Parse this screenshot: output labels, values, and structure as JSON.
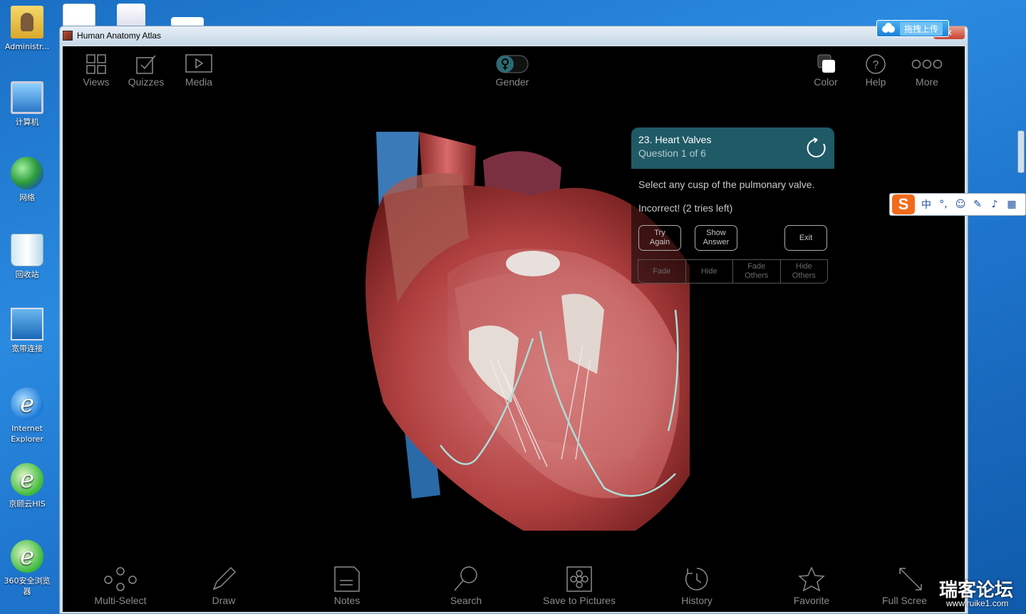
{
  "desktop": {
    "icons": [
      {
        "label": "Administr..."
      },
      {
        "label": "计算机"
      },
      {
        "label": "网络"
      },
      {
        "label": "回收站"
      },
      {
        "label": "宽带连接"
      },
      {
        "label": "Internet Explorer"
      },
      {
        "label": "京颐云HIS"
      },
      {
        "label": "360安全浏览器"
      }
    ]
  },
  "window": {
    "title": "Human Anatomy Atlas",
    "close_label": "✕"
  },
  "toolbar_top": {
    "views": "Views",
    "quizzes": "Quizzes",
    "media": "Media",
    "gender": "Gender",
    "color": "Color",
    "help": "Help",
    "more": "More"
  },
  "quiz": {
    "title": "23. Heart Valves",
    "subtitle": "Question 1 of 6",
    "question": "Select any cusp of the pulmonary valve.",
    "feedback": "Incorrect! (2 tries left)",
    "buttons": {
      "try_again": "Try\nAgain",
      "show_answer": "Show\nAnswer",
      "exit": "Exit"
    },
    "actions": {
      "fade": "Fade",
      "hide": "Hide",
      "fade_others": "Fade\nOthers",
      "hide_others": "Hide\nOthers"
    }
  },
  "toolbar_bottom": {
    "multi_select": "Multi-Select",
    "draw": "Draw",
    "notes": "Notes",
    "search": "Search",
    "save_to_pictures": "Save to Pictures",
    "history": "History",
    "favorite": "Favorite",
    "full_screen": "Full Scree"
  },
  "overlay": {
    "upload_label": "拖拽上传",
    "ime_items": [
      "中",
      "°,",
      "☺",
      "✎",
      "♪",
      "▦"
    ],
    "watermark": "瑞客论坛",
    "watermark_url": "www.ruike1.com"
  },
  "colors": {
    "quiz_header": "#1f5a66",
    "toolbar_text": "#8a8a8a",
    "desktop_bg": "#1e74cc"
  }
}
